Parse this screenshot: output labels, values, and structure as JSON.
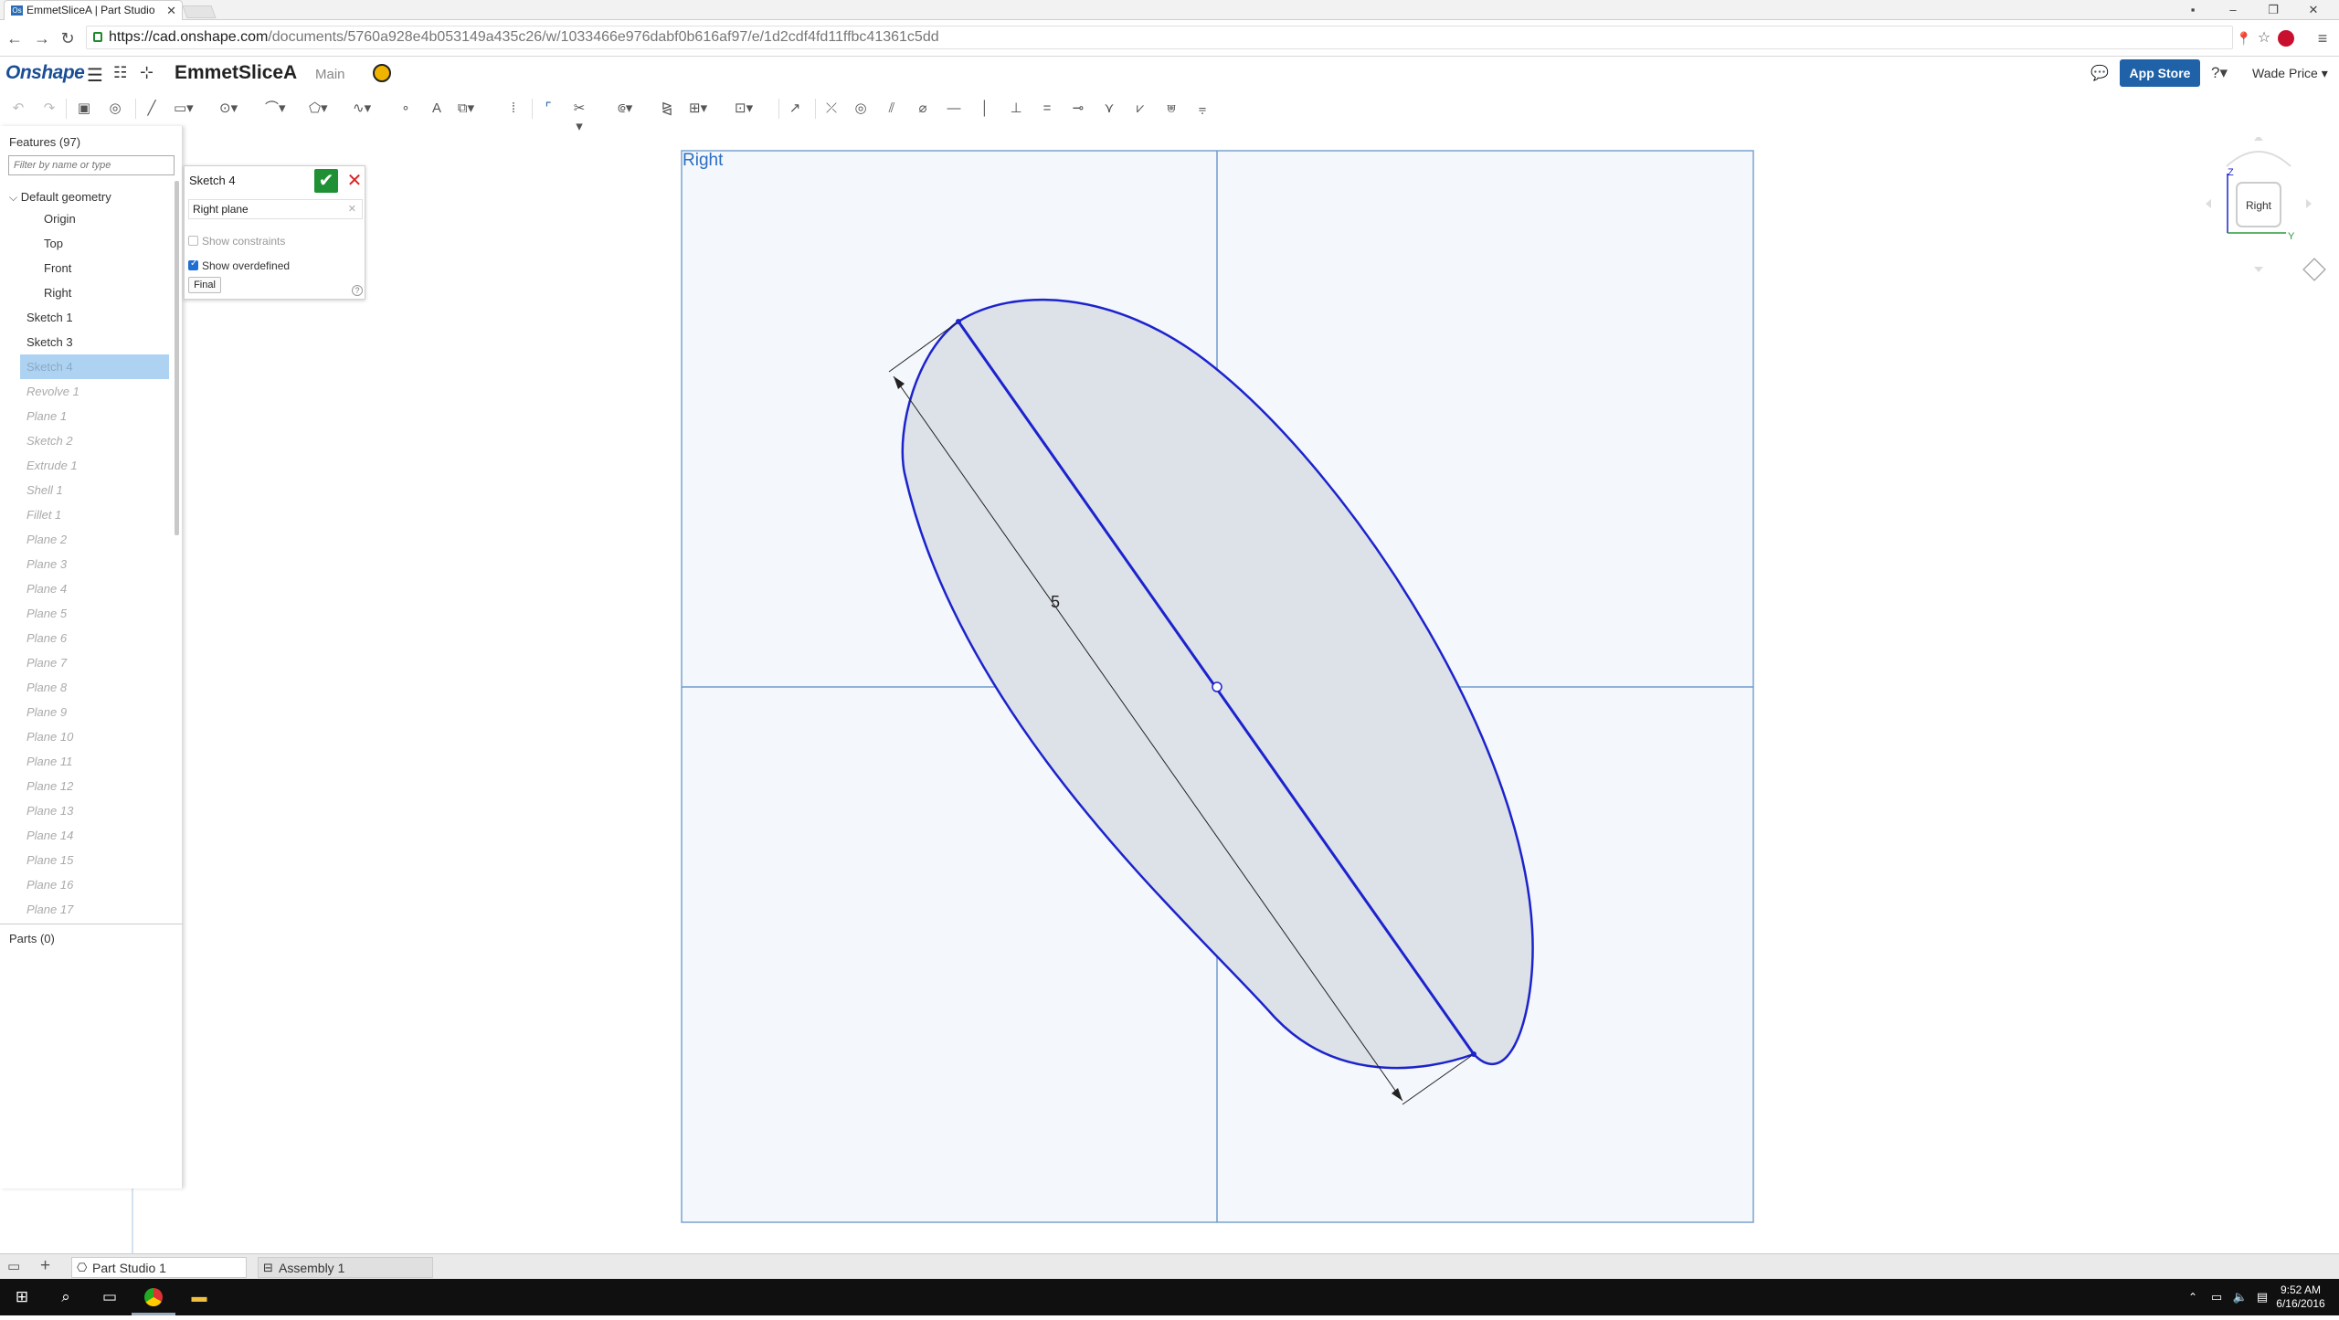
{
  "browser": {
    "tab_title": "EmmetSliceA | Part Studio",
    "tab_favicon": "Os",
    "url_domain": "https://cad.onshape.com",
    "url_path": "/documents/5760a928e4b053149a435c26/w/1033466e976dabf0b616af97/e/1d2cdf4fd11ffbc41361c5dd"
  },
  "header": {
    "logo": "Onshape",
    "document_title": "EmmetSliceA",
    "branch": "Main",
    "app_store": "App Store",
    "user": "Wade Price"
  },
  "feature_tree": {
    "title": "Features (97)",
    "filter_placeholder": "Filter by name or type",
    "default_geometry": "Default geometry",
    "geometry": [
      "Origin",
      "Top",
      "Front",
      "Right"
    ],
    "features": [
      {
        "label": "Sketch 1",
        "state": "active"
      },
      {
        "label": "Sketch 3",
        "state": "active"
      },
      {
        "label": "Sketch 4",
        "state": "selected"
      },
      {
        "label": "Revolve 1",
        "state": "rolled"
      },
      {
        "label": "Plane 1",
        "state": "rolled"
      },
      {
        "label": "Sketch 2",
        "state": "rolled"
      },
      {
        "label": "Extrude 1",
        "state": "rolled"
      },
      {
        "label": "Shell 1",
        "state": "rolled"
      },
      {
        "label": "Fillet 1",
        "state": "rolled"
      },
      {
        "label": "Plane 2",
        "state": "rolled"
      },
      {
        "label": "Plane 3",
        "state": "rolled"
      },
      {
        "label": "Plane 4",
        "state": "rolled"
      },
      {
        "label": "Plane 5",
        "state": "rolled"
      },
      {
        "label": "Plane 6",
        "state": "rolled"
      },
      {
        "label": "Plane 7",
        "state": "rolled"
      },
      {
        "label": "Plane 8",
        "state": "rolled"
      },
      {
        "label": "Plane 9",
        "state": "rolled"
      },
      {
        "label": "Plane 10",
        "state": "rolled"
      },
      {
        "label": "Plane 11",
        "state": "rolled"
      },
      {
        "label": "Plane 12",
        "state": "rolled"
      },
      {
        "label": "Plane 13",
        "state": "rolled"
      },
      {
        "label": "Plane 14",
        "state": "rolled"
      },
      {
        "label": "Plane 15",
        "state": "rolled"
      },
      {
        "label": "Plane 16",
        "state": "rolled"
      },
      {
        "label": "Plane 17",
        "state": "rolled"
      }
    ],
    "parts_title": "Parts (0)"
  },
  "sketch_dialog": {
    "title": "Sketch 4",
    "plane": "Right plane",
    "show_constraints": {
      "label": "Show constraints",
      "checked": false
    },
    "show_overdefined": {
      "label": "Show overdefined",
      "checked": true
    },
    "final_button": "Final",
    "help": "?"
  },
  "viewport": {
    "view_label": "Right",
    "dimension": "5",
    "view_cube": {
      "face": "Right",
      "axis_z": "Z",
      "axis_y": "Y"
    }
  },
  "bottom_tabs": [
    "Part Studio 1",
    "Assembly 1"
  ],
  "taskbar": {
    "time": "9:52 AM",
    "date": "6/16/2016"
  },
  "colors": {
    "brand": "#1a4f95",
    "app_store": "#1f62a8",
    "sketch_blue": "#1c23cc",
    "selected_row": "#aed3f2",
    "accept_green": "#1f9134"
  }
}
